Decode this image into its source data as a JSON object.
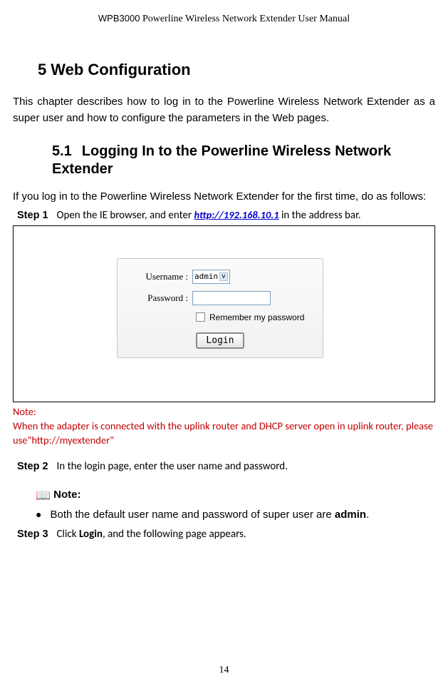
{
  "header": {
    "product": "WPB3000",
    "rest": " Powerline Wireless Network Extender User Manual"
  },
  "chapter": {
    "num": "5",
    "title": "Web Configuration"
  },
  "intro": "This chapter describes how to log in to the Powerline Wireless Network Extender as a super user and how to configure the parameters in the Web pages.",
  "section": {
    "num": "5.1",
    "title_line1": "Logging In to the Powerline Wireless Network",
    "title_line2": "Extender"
  },
  "section_intro": "If you log in to the Powerline Wireless Network Extender for the first time, do as follows:",
  "step1": {
    "label": "Step 1",
    "before": "Open the IE browser, and enter ",
    "link": "http://192.168.10.1",
    "after": " in the address bar."
  },
  "login_panel": {
    "username_label": "Username :",
    "username_value": "admin",
    "password_label": "Password :",
    "remember": "Remember my password",
    "button": "Login"
  },
  "note_red": {
    "l1": "Note:",
    "l2": "When the adapter is connected with the uplink router and DHCP server open in uplink router, please use\"http://myextender\""
  },
  "step2": {
    "label": "Step 2",
    "text": "In the login page, enter the user name and password."
  },
  "note_block": {
    "label": "Note:",
    "bullet": "Both the default user name and password of super user are ",
    "bold": "admin",
    "after": "."
  },
  "step3": {
    "label": "Step 3",
    "before": "Click ",
    "bold": "Login",
    "after": ", and the following page appears."
  },
  "page_num": "14"
}
